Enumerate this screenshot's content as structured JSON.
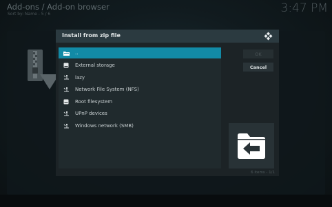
{
  "header": {
    "title": "Add-ons / Add-on browser",
    "subtitle": "Sort by: Name - 5 / 6",
    "clock": "3:47 PM"
  },
  "dialog": {
    "title": "Install from zip file",
    "items": [
      {
        "label": "..",
        "icon": "folder-icon",
        "selected": true
      },
      {
        "label": "External storage",
        "icon": "drive-icon",
        "selected": false
      },
      {
        "label": "lazy",
        "icon": "network-icon",
        "selected": false
      },
      {
        "label": "Network File System (NFS)",
        "icon": "network-icon",
        "selected": false
      },
      {
        "label": "Root filesystem",
        "icon": "drive-icon",
        "selected": false
      },
      {
        "label": "UPnP devices",
        "icon": "network-icon",
        "selected": false
      },
      {
        "label": "Windows network (SMB)",
        "icon": "network-icon",
        "selected": false
      }
    ],
    "buttons": {
      "ok": "OK",
      "cancel": "Cancel"
    },
    "footer": "6 items - 1/1"
  },
  "colors": {
    "accent": "#128aa6",
    "dialog_header": "#2b3a40",
    "dialog_body": "#1c2326"
  }
}
